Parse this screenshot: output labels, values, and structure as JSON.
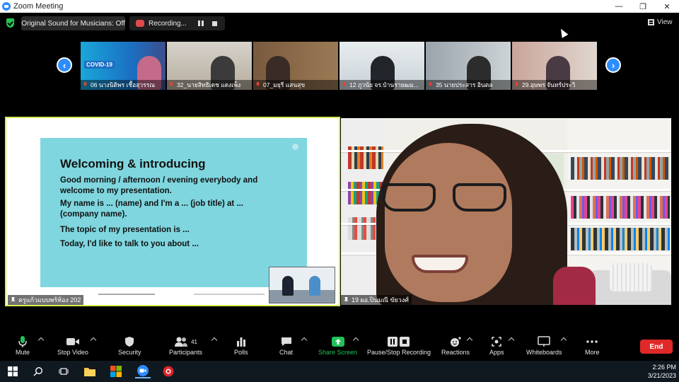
{
  "window": {
    "title": "Zoom Meeting"
  },
  "topbar": {
    "sound_label": "Original Sound for Musicians: Off",
    "recording_label": "Recording...",
    "view_label": "View"
  },
  "gallery": [
    {
      "name": "06 นางนิติพร เชื้อสุวรรณ"
    },
    {
      "name": "32_นายสิทธิเดช แดงเพ็ง"
    },
    {
      "name": "07_มยุรี แสนสุข"
    },
    {
      "name": "12 ภูวนัย จร.บ้านรายฒม..."
    },
    {
      "name": "35 นายประสาร อินตล"
    },
    {
      "name": "29.อุษพร จันทร์ประวิ"
    }
  ],
  "gallery_covid_text": "COVID-19",
  "share": {
    "title": "Welcoming & introducing",
    "lines": [
      "Good morning / afternoon / evening everybody and",
      "welcome to my presentation.",
      "My name is ... (name) and I'm a ... (job title) at ...",
      "(company name).",
      "The topic of my presentation is ...",
      "Today, I'd like to talk to you about ..."
    ],
    "name_tag": "ครูแก้วแบบพร้ห้อง 202"
  },
  "speaker": {
    "name_tag": "19 ผอ.ปินมณี ขัยวงศ์"
  },
  "toolbar": {
    "mute": "Mute",
    "stop_video": "Stop Video",
    "security": "Security",
    "participants": "Participants",
    "participants_count": "41",
    "polls": "Polls",
    "chat": "Chat",
    "share_screen": "Share Screen",
    "pause_stop": "Pause/Stop Recording",
    "reactions": "Reactions",
    "apps": "Apps",
    "whiteboards": "Whiteboards",
    "more": "More",
    "end": "End"
  },
  "taskbar": {
    "time": "2:26 PM",
    "date": "3/21/2023"
  },
  "colors": {
    "accent": "#2d8cff",
    "share_border": "#d4f056",
    "end": "#e02828",
    "green": "#23c552"
  }
}
